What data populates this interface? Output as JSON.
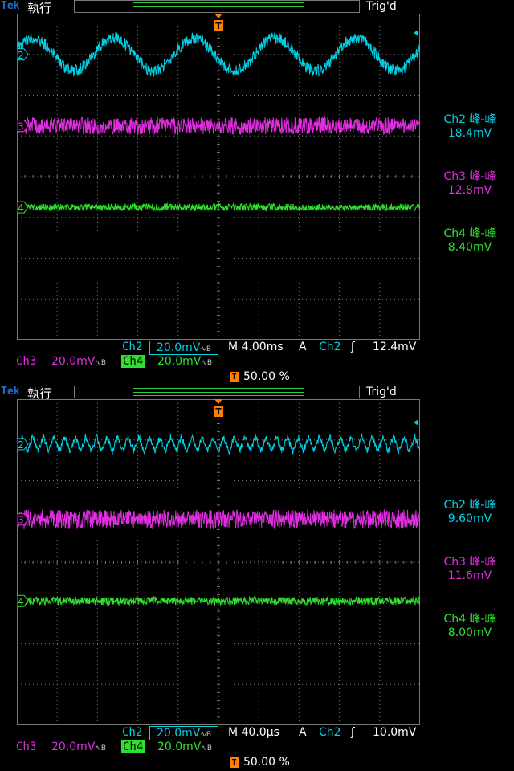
{
  "header": {
    "brand": "Tek",
    "run_state": "執行",
    "trigger_status": "Trig'd"
  },
  "colors": {
    "ch2": "#00d2e6",
    "ch3": "#e02ee0",
    "ch4": "#2fe02f",
    "trigger": "#ff7f00",
    "grid": "#777777"
  },
  "icons": {
    "trigger_marker": "trigger-T-icon",
    "edge": "rising-edge-icon",
    "bandwidth": "bandwidth-limit-icon"
  },
  "panels": [
    {
      "measurements": [
        {
          "label": "Ch2 峰-峰",
          "value": "18.4mV"
        },
        {
          "label": "Ch3 峰-峰",
          "value": "12.8mV"
        },
        {
          "label": "Ch4 峰-峰",
          "value": "8.40mV"
        }
      ],
      "status": {
        "ch2_name": "Ch2",
        "ch2_scale": "20.0mV",
        "timebase": "M 4.00ms",
        "trig_mode": "A",
        "trig_source": "Ch2",
        "trig_level": "12.4mV",
        "ch3_name": "Ch3",
        "ch3_scale": "20.0mV",
        "ch4_name": "Ch4",
        "ch4_scale": "20.0mV",
        "trig_position": "50.00 %"
      }
    },
    {
      "measurements": [
        {
          "label": "Ch2 峰-峰",
          "value": "9.60mV"
        },
        {
          "label": "Ch3 峰-峰",
          "value": "11.6mV"
        },
        {
          "label": "Ch4 峰-峰",
          "value": "8.00mV"
        }
      ],
      "status": {
        "ch2_name": "Ch2",
        "ch2_scale": "20.0mV",
        "timebase": "M 40.0µs",
        "trig_mode": "A",
        "trig_source": "Ch2",
        "trig_level": "10.0mV",
        "ch3_name": "Ch3",
        "ch3_scale": "20.0mV",
        "ch4_name": "Ch4",
        "ch4_scale": "20.0mV",
        "trig_position": "50.00 %"
      }
    }
  ],
  "chart_data": [
    {
      "type": "line",
      "grid": true,
      "x_divisions": 10,
      "y_divisions": 8,
      "channel_markers": [
        "2",
        "3",
        "4"
      ],
      "series": [
        {
          "name": "Ch2",
          "waveform": "sine",
          "cycles": 5,
          "offset_div": 7.0,
          "amplitude_div": 0.4,
          "noise_div": 0.15
        },
        {
          "name": "Ch3",
          "waveform": "noise",
          "offset_div": 5.25,
          "noise_div": 0.21
        },
        {
          "name": "Ch4",
          "waveform": "noise",
          "offset_div": 3.25,
          "noise_div": 0.09
        }
      ]
    },
    {
      "type": "line",
      "grid": true,
      "x_divisions": 10,
      "y_divisions": 8,
      "channel_markers": [
        "2",
        "3",
        "4"
      ],
      "series": [
        {
          "name": "Ch2",
          "waveform": "triangle",
          "cycles": 38,
          "offset_div": 6.9,
          "amplitude_div": 0.18,
          "noise_div": 0.08
        },
        {
          "name": "Ch3",
          "waveform": "noise",
          "offset_div": 5.05,
          "noise_div": 0.24
        },
        {
          "name": "Ch4",
          "waveform": "noise",
          "offset_div": 3.05,
          "noise_div": 0.1
        }
      ]
    }
  ]
}
